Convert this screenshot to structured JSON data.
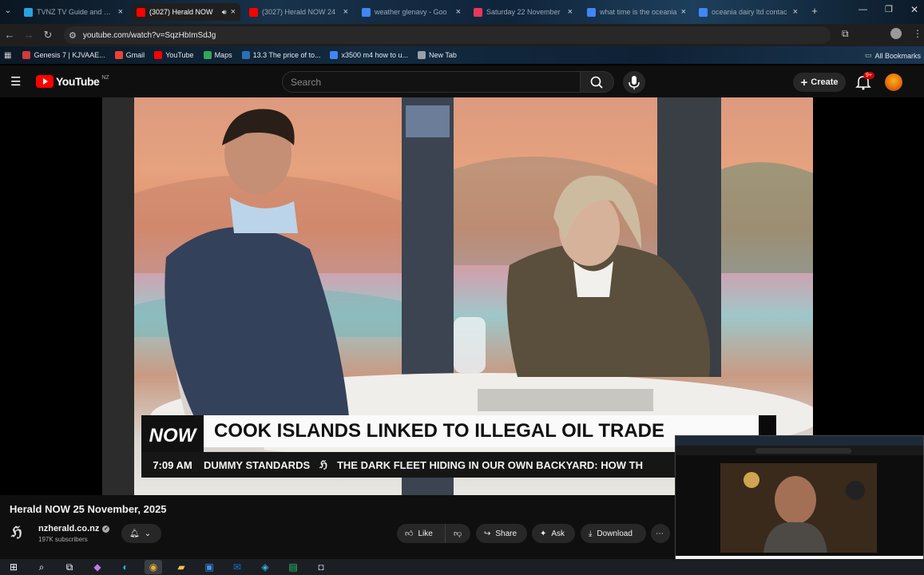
{
  "browser": {
    "tabs": [
      {
        "title": "TVNZ TV Guide and Free",
        "favicon_color": "#29a3e0",
        "active": false
      },
      {
        "title": "(3027) Herald NOW",
        "favicon_color": "#ff0000",
        "active": true
      },
      {
        "title": "(3027) Herald NOW 24",
        "favicon_color": "#ff0000",
        "active": false
      },
      {
        "title": "weather glenavy - Goo",
        "favicon_color": "#4285f4",
        "active": false
      },
      {
        "title": "Saturday 22 November",
        "favicon_color": "#e8365d",
        "active": false
      },
      {
        "title": "what time is the oceania",
        "favicon_color": "#4285f4",
        "active": false
      },
      {
        "title": "oceania dairy ltd contac",
        "favicon_color": "#4285f4",
        "active": false
      }
    ],
    "url": "youtube.com/watch?v=SqzHbImSdJg",
    "bookmarks": [
      {
        "label": "Genesis 7 | KJVAAE...",
        "color": "#d23b3b"
      },
      {
        "label": "Gmail",
        "color": "#ea4335"
      },
      {
        "label": "YouTube",
        "color": "#ff0000"
      },
      {
        "label": "Maps",
        "color": "#34a853"
      },
      {
        "label": "13.3 The price of to...",
        "color": "#2c6fb5"
      },
      {
        "label": "x3500 m4 how to u...",
        "color": "#4285f4"
      },
      {
        "label": "New Tab",
        "color": "#9aa0a6"
      }
    ],
    "all_bookmarks": "All Bookmarks"
  },
  "youtube": {
    "logo_text": "YouTube",
    "region": "NZ",
    "search_placeholder": "Search",
    "create_label": "Create",
    "notif_count": "9+",
    "lower_third": {
      "tag": "NOW",
      "headline": "COOK ISLANDS LINKED TO ILLEGAL OIL TRADE",
      "time": "7:09 AM",
      "ticker_left": "DUMMY STANDARDS",
      "ticker_right": "THE DARK FLEET HIDING IN OUR OWN BACKYARD: HOW TH"
    },
    "video_title": "Herald NOW 25 November, 2025",
    "channel": {
      "name": "nzherald.co.nz",
      "subscribers": "197K subscribers"
    },
    "actions": {
      "like": "Like",
      "share": "Share",
      "ask": "Ask",
      "download": "Download"
    }
  }
}
